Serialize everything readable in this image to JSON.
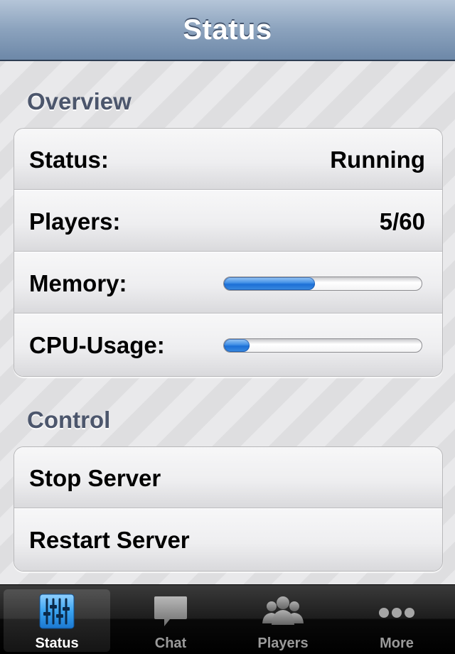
{
  "navbar": {
    "title": "Status"
  },
  "sections": {
    "overview": {
      "header": "Overview",
      "rows": {
        "status": {
          "label": "Status:",
          "value": "Running"
        },
        "players": {
          "label": "Players:",
          "value": "5/60"
        },
        "memory": {
          "label": "Memory:",
          "progress_fraction": 0.46
        },
        "cpu": {
          "label": "CPU-Usage:",
          "progress_fraction": 0.13
        }
      }
    },
    "control": {
      "header": "Control",
      "rows": {
        "stop": {
          "label": "Stop Server"
        },
        "restart": {
          "label": "Restart Server"
        }
      }
    }
  },
  "tabbar": {
    "selected": "status",
    "tabs": {
      "status": {
        "label": "Status",
        "icon": "equalizer-sliders-icon"
      },
      "chat": {
        "label": "Chat",
        "icon": "speech-bubble-icon"
      },
      "players": {
        "label": "Players",
        "icon": "people-group-icon"
      },
      "more": {
        "label": "More",
        "icon": "ellipsis-icon"
      }
    }
  },
  "colors": {
    "navbar": "#7f97b4",
    "progress_fill": "#2f80e0",
    "section_header": "#4c566c",
    "active_icon": "#3aa3f0"
  }
}
